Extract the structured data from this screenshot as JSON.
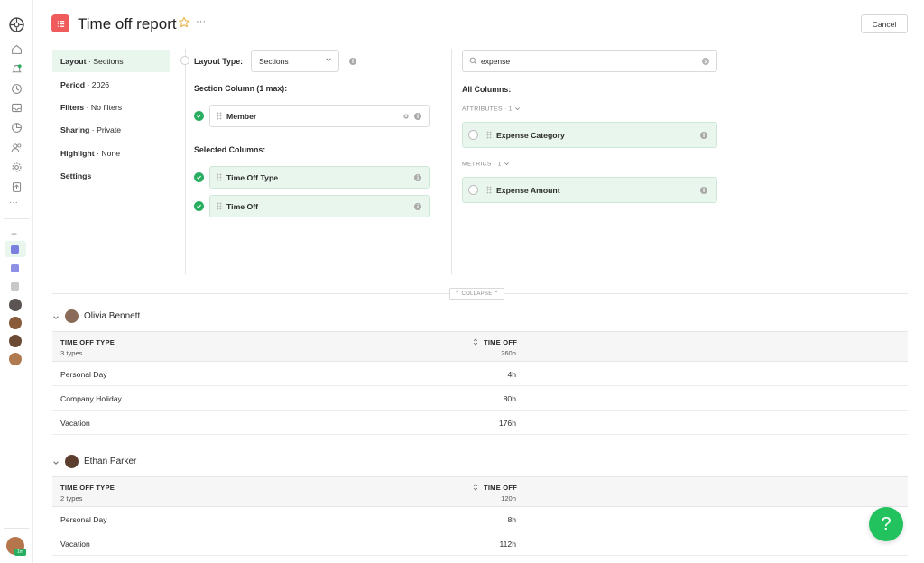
{
  "header": {
    "title": "Time off report",
    "cancel_label": "Cancel",
    "more_label": "···"
  },
  "nav": [
    {
      "key": "Layout",
      "value": "Sections"
    },
    {
      "key": "Period",
      "value": "2026"
    },
    {
      "key": "Filters",
      "value": "No filters"
    },
    {
      "key": "Sharing",
      "value": "Private"
    },
    {
      "key": "Highlight",
      "value": "None"
    },
    {
      "key": "Settings",
      "value": ""
    }
  ],
  "nav_sep": " · ",
  "layout": {
    "layout_type_label": "Layout Type:",
    "layout_type_value": "Sections",
    "section_column_label": "Section Column (1 max):",
    "section_column_value": "Member",
    "selected_columns_label": "Selected Columns:",
    "selected_columns": [
      "Time Off Type",
      "Time Off"
    ]
  },
  "columns": {
    "search_value": "expense",
    "all_columns_label": "All Columns:",
    "attributes_label": "ATTRIBUTES · 1",
    "attribute_items": [
      "Expense Category"
    ],
    "metrics_label": "METRICS · 1",
    "metric_items": [
      "Expense Amount"
    ]
  },
  "collapse_label": "⌃ COLLAPSE ⌃",
  "sections": [
    {
      "member": "Olivia Bennett",
      "col1_header": "TIME OFF TYPE",
      "col1_sub": "3 types",
      "col2_header": "TIME OFF",
      "col2_sub": "260h",
      "rows": [
        {
          "type": "Personal Day",
          "hours": "4h"
        },
        {
          "type": "Company Holiday",
          "hours": "80h"
        },
        {
          "type": "Vacation",
          "hours": "176h"
        }
      ]
    },
    {
      "member": "Ethan Parker",
      "col1_header": "TIME OFF TYPE",
      "col1_sub": "2 types",
      "col2_header": "TIME OFF",
      "col2_sub": "120h",
      "rows": [
        {
          "type": "Personal Day",
          "hours": "8h"
        },
        {
          "type": "Vacation",
          "hours": "112h"
        }
      ]
    }
  ],
  "rail": {
    "more_label": "···",
    "add_label": "+",
    "user_badge": "1m"
  },
  "help_label": "?",
  "colors": {
    "accent_green": "#27ae60",
    "report_red": "#ef5b5b",
    "highlight_green": "#e9f6ee",
    "help_green": "#22c35e",
    "violet": "#7b7fe0"
  }
}
